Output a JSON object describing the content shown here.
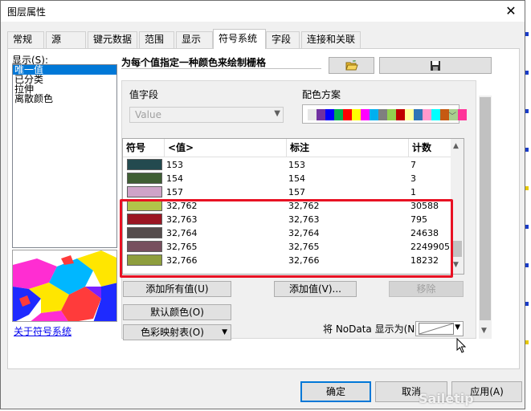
{
  "window": {
    "title": "图层属性",
    "close_icon": "close-icon"
  },
  "tabs": [
    {
      "label": "常规"
    },
    {
      "label": "源"
    },
    {
      "label": "键元数据"
    },
    {
      "label": "范围"
    },
    {
      "label": "显示"
    },
    {
      "label": "符号系统",
      "active": true
    },
    {
      "label": "字段"
    },
    {
      "label": "连接和关联"
    }
  ],
  "show": {
    "label": "显示(S):",
    "items": [
      {
        "label": "唯一值",
        "selected": true
      },
      {
        "label": "已分类"
      },
      {
        "label": "拉伸"
      },
      {
        "label": "离散颜色"
      }
    ],
    "about_link": "关于符号系统"
  },
  "main": {
    "heading": "为每个值指定一种颜色来绘制栅格",
    "open_icon": "folder-open-icon",
    "save_icon": "save-disk-icon",
    "value_field": {
      "label": "值字段",
      "value": "Value"
    },
    "color_scheme": {
      "label": "配色方案",
      "colors": [
        "#e6e6e6",
        "#7030a0",
        "#0000ff",
        "#00b050",
        "#ff0000",
        "#ffff00",
        "#ff00ff",
        "#00b0f0",
        "#7f7f7f",
        "#92d050",
        "#c00000",
        "#ffff99",
        "#2e75b6",
        "#ff99cc",
        "#00ffff",
        "#c65911",
        "#a9d08e",
        "#ff3399"
      ]
    }
  },
  "table": {
    "headers": [
      "符号",
      "<值>",
      "标注",
      "计数"
    ],
    "rows": [
      {
        "color": "#234a4f",
        "value": "153",
        "label": "153",
        "count": "7"
      },
      {
        "color": "#3f5e33",
        "value": "154",
        "label": "154",
        "count": "3"
      },
      {
        "color": "#cfa3c8",
        "value": "157",
        "label": "157",
        "count": "1"
      },
      {
        "color": "#b1c449",
        "value": "32,762",
        "label": "32,762",
        "count": "30588"
      },
      {
        "color": "#9b1623",
        "value": "32,763",
        "label": "32,763",
        "count": "795"
      },
      {
        "color": "#554c4c",
        "value": "32,764",
        "label": "32,764",
        "count": "24638"
      },
      {
        "color": "#774f5e",
        "value": "32,765",
        "label": "32,765",
        "count": "2249905"
      },
      {
        "color": "#8e9e3d",
        "value": "32,766",
        "label": "32,766",
        "count": "18232"
      }
    ]
  },
  "buttons": {
    "add_all": "添加所有值(U)",
    "add_values": "添加值(V)...",
    "remove": "移除",
    "default_colors": "默认颜色(O)",
    "colormap": "色彩映射表(O)"
  },
  "nodata": {
    "label": "将 NoData 显示为(N)"
  },
  "footer": {
    "ok": "确定",
    "cancel": "取消",
    "apply": "应用(A)"
  },
  "watermark": "Sailetip",
  "colors": {
    "highlight": "#e81123",
    "selection": "#0078d7"
  }
}
